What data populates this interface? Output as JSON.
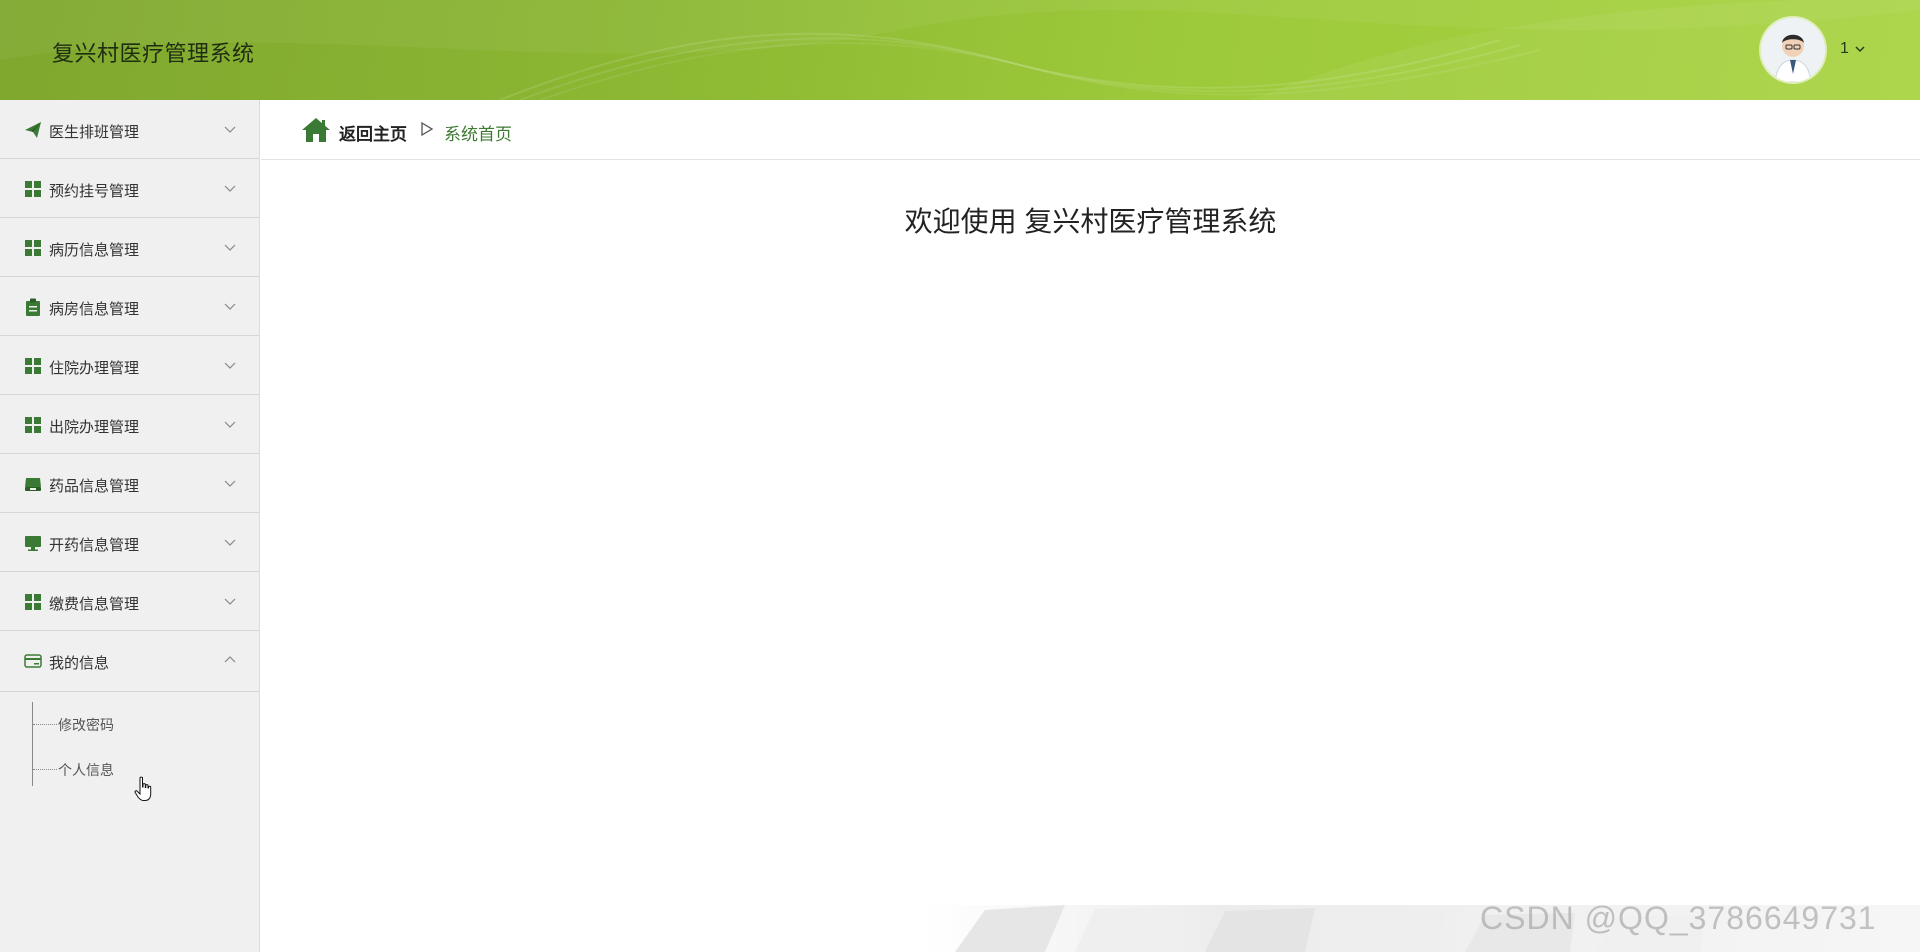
{
  "header": {
    "title": "复兴村医疗管理系统",
    "user_name": "1",
    "accent_color": "#8cb833"
  },
  "sidebar": {
    "items": [
      {
        "label": "医生排班管理",
        "icon": "paper-plane-icon"
      },
      {
        "label": "预约挂号管理",
        "icon": "grid-icon"
      },
      {
        "label": "病历信息管理",
        "icon": "grid-icon"
      },
      {
        "label": "病房信息管理",
        "icon": "clipboard-icon"
      },
      {
        "label": "住院办理管理",
        "icon": "grid-icon"
      },
      {
        "label": "出院办理管理",
        "icon": "grid-icon"
      },
      {
        "label": "药品信息管理",
        "icon": "tray-icon"
      },
      {
        "label": "开药信息管理",
        "icon": "monitor-icon"
      },
      {
        "label": "缴费信息管理",
        "icon": "grid-icon"
      },
      {
        "label": "我的信息",
        "icon": "card-icon",
        "expanded": true
      }
    ],
    "submenu": [
      {
        "label": "修改密码"
      },
      {
        "label": "个人信息"
      }
    ]
  },
  "breadcrumb": {
    "home": "返回主页",
    "current": "系统首页"
  },
  "main": {
    "welcome": "欢迎使用 复兴村医疗管理系统"
  },
  "watermark": "CSDN @QQ_3786649731"
}
